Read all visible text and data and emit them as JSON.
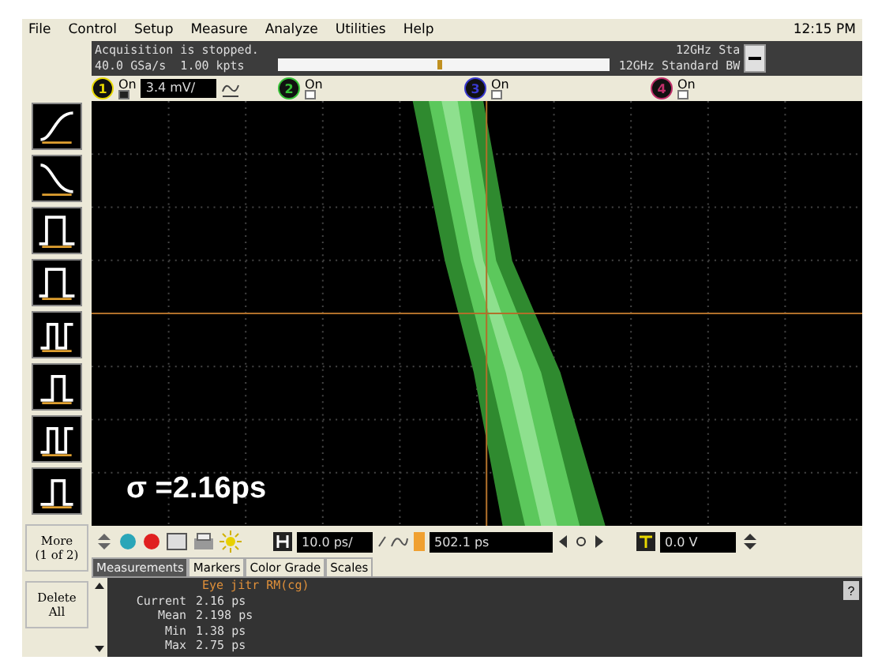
{
  "menu": [
    "File",
    "Control",
    "Setup",
    "Measure",
    "Analyze",
    "Utilities",
    "Help"
  ],
  "clock": "12:15 PM",
  "status": {
    "line1": "Acquisition is stopped.",
    "line2": "40.0 GSa/s  1.00 kpts",
    "bw_top": "12GHz Sta",
    "bw": "12GHz Standard BW",
    "level": 0.48
  },
  "channels": [
    {
      "number": "1",
      "color": "#e8d800",
      "label": "On",
      "checked": true,
      "scale": "3.4 mV/"
    },
    {
      "number": "2",
      "color": "#36c036",
      "label": "On",
      "checked": false
    },
    {
      "number": "3",
      "color": "#3a3ad0",
      "label": "On",
      "checked": false
    },
    {
      "number": "4",
      "color": "#c0306a",
      "label": "On",
      "checked": false
    }
  ],
  "side_buttons": [
    "More\n(1 of 2)",
    "Delete\nAll"
  ],
  "overlay": "σ =2.16ps",
  "toolbar": {
    "horizontal": "10.0 ps/",
    "delay": "502.1 ps",
    "trigger": "0.0 V"
  },
  "tabs": [
    {
      "label": "Measurements",
      "selected": true
    },
    {
      "label": "Markers",
      "selected": false
    },
    {
      "label": "Color Grade",
      "selected": false
    },
    {
      "label": "Scales",
      "selected": false
    }
  ],
  "measurement": {
    "title": "Eye jitr RM(cg)",
    "help": "?",
    "rows": [
      {
        "label": "Current",
        "value": "2.16 ps"
      },
      {
        "label": "Mean",
        "value": "2.198 ps"
      },
      {
        "label": "Min",
        "value": "1.38 ps"
      },
      {
        "label": "Max",
        "value": "2.75 ps"
      }
    ]
  }
}
